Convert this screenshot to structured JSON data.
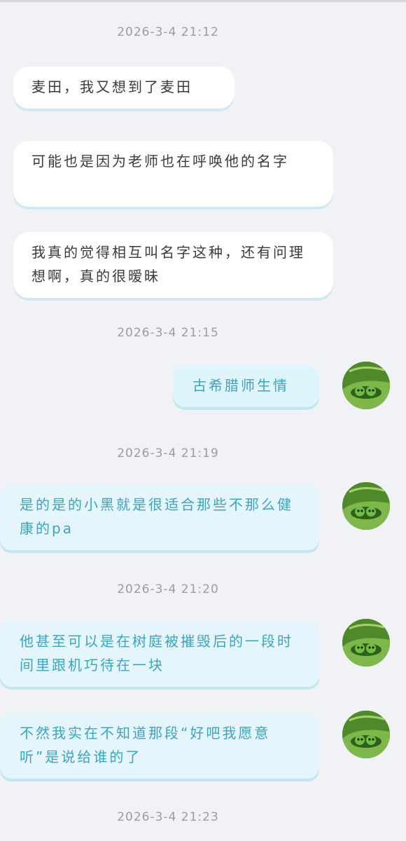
{
  "timestamps": [
    "2026-3-4  21:12",
    "2026-3-4  21:15",
    "2026-3-4  21:19",
    "2026-3-4  21:20",
    "2026-3-4  21:23"
  ],
  "messages": [
    {
      "text": "麦田，我又想到了麦田",
      "side": "left"
    },
    {
      "text": "可能也是因为老师也在呼唤他的名字",
      "side": "left"
    },
    {
      "text": "我真的觉得相互叫名字这种，还有问理想啊，真的很暧昧",
      "side": "left"
    },
    {
      "text": "古希腊师生情",
      "side": "right"
    },
    {
      "text": "是的是的小黑就是很适合那些不那么健康的pa",
      "side": "right"
    },
    {
      "text": "他甚至可以是在树庭被摧毁后的一段时间里跟机巧待在一块",
      "side": "right"
    },
    {
      "text": "不然我实在不知道那段“好吧我愿意听”是说给谁的了",
      "side": "right"
    }
  ],
  "avatar": {
    "icon": "green-pea-avatar-icon"
  },
  "colors": {
    "background": "#f1f2f6",
    "left_bubble": "#ffffff",
    "right_bubble": "#dff5fc",
    "right_text": "#3aa4c2",
    "timestamp": "#9c9ca1"
  }
}
